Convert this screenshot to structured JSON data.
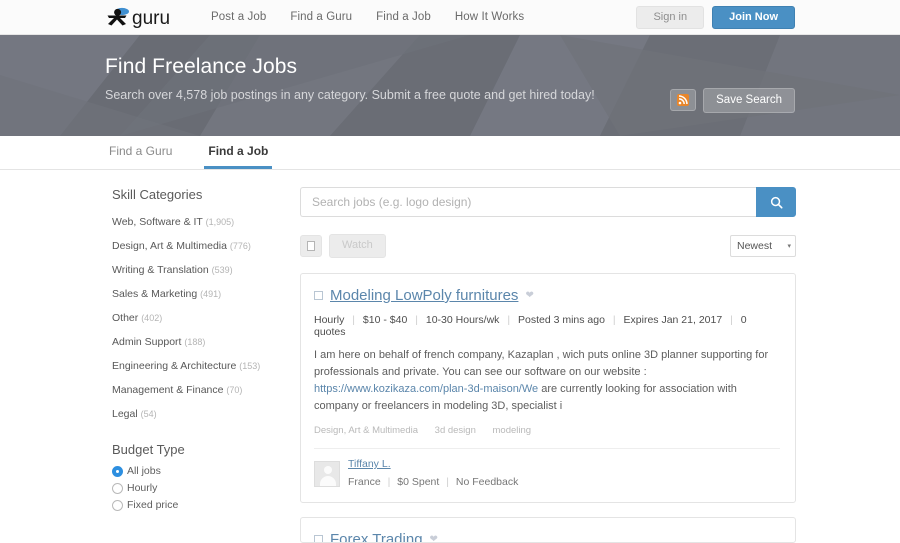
{
  "brand": {
    "name": "guru",
    "accent": "#4a90c4",
    "rss_color": "#e8862a"
  },
  "topnav": {
    "items": [
      {
        "label": "Post a Job"
      },
      {
        "label": "Find a Guru"
      },
      {
        "label": "Find a Job"
      },
      {
        "label": "How It Works"
      }
    ],
    "signin_label": "Sign in",
    "join_label": "Join Now"
  },
  "hero": {
    "title": "Find Freelance Jobs",
    "subtitle": "Search over 4,578 job postings in any category. Submit a free quote and get hired today!",
    "rss_icon": "rss-icon",
    "save_search_label": "Save Search"
  },
  "tabs": [
    {
      "label": "Find a Guru",
      "active": false
    },
    {
      "label": "Find a Job",
      "active": true
    }
  ],
  "sidebar": {
    "skill_heading": "Skill Categories",
    "categories": [
      {
        "label": "Web, Software & IT",
        "count": "(1,905)"
      },
      {
        "label": "Design, Art & Multimedia",
        "count": "(776)"
      },
      {
        "label": "Writing & Translation",
        "count": "(539)"
      },
      {
        "label": "Sales & Marketing",
        "count": "(491)"
      },
      {
        "label": "Other",
        "count": "(402)"
      },
      {
        "label": "Admin Support",
        "count": "(188)"
      },
      {
        "label": "Engineering & Architecture",
        "count": "(153)"
      },
      {
        "label": "Management & Finance",
        "count": "(70)"
      },
      {
        "label": "Legal",
        "count": "(54)"
      }
    ],
    "budget_heading": "Budget Type",
    "budget_options": [
      {
        "label": "All jobs",
        "selected": true
      },
      {
        "label": "Hourly",
        "selected": false
      },
      {
        "label": "Fixed price",
        "selected": false
      }
    ]
  },
  "search": {
    "placeholder": "Search jobs (e.g. logo design)",
    "value": "",
    "button_icon": "search-icon"
  },
  "toolbar": {
    "select_all_icon": "checkbox-icon",
    "watch_label": "Watch",
    "sort_value": "Newest",
    "sort_caret": "▾"
  },
  "jobs": [
    {
      "title": "Modeling LowPoly furnitures",
      "favorite_icon": "heart-icon",
      "meta": [
        "Hourly",
        "$10 - $40",
        "10-30 Hours/wk",
        "Posted 3 mins ago",
        "Expires Jan 21, 2017",
        "0 quotes"
      ],
      "description_before": "I am here on behalf of french company, Kazaplan , wich puts online 3D planner supporting for professionals and private. You can see our software on our website : ",
      "description_link": "https://www.kozikaza.com/plan-3d-maison/We",
      "description_after": " are currently looking for association with company or freelancers in modeling 3D, specialist i",
      "tags": [
        "Design, Art & Multimedia",
        "3d design",
        "modeling"
      ],
      "poster_name": "Tiffany L.",
      "poster_meta": [
        "France",
        "$0 Spent",
        "No Feedback"
      ]
    },
    {
      "title": "Forex Trading"
    }
  ]
}
